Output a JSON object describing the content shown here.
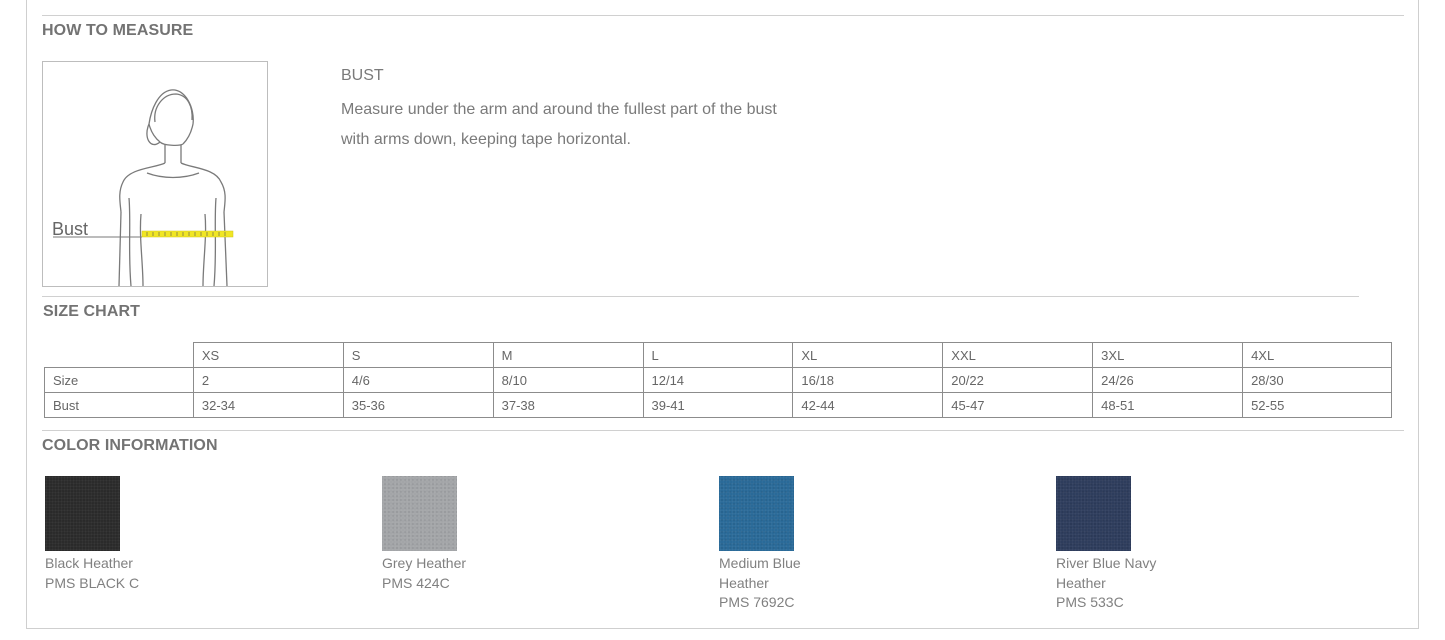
{
  "sections": {
    "how_to_measure": "HOW TO MEASURE",
    "size_chart": "SIZE CHART",
    "color_information": "COLOR INFORMATION"
  },
  "measure": {
    "figure_label": "Bust",
    "title": "BUST",
    "description_line1": "Measure under the arm and around the fullest part of the bust",
    "description_line2": "with arms down, keeping tape horizontal."
  },
  "size_table": {
    "headers": [
      "XS",
      "S",
      "M",
      "L",
      "XL",
      "XXL",
      "3XL",
      "4XL"
    ],
    "rows": [
      {
        "label": "Size",
        "values": [
          "2",
          "4/6",
          "8/10",
          "12/14",
          "16/18",
          "20/22",
          "24/26",
          "28/30"
        ]
      },
      {
        "label": "Bust",
        "values": [
          "32-34",
          "35-36",
          "37-38",
          "39-41",
          "42-44",
          "45-47",
          "48-51",
          "52-55"
        ]
      }
    ]
  },
  "colors": [
    {
      "name_lines": [
        "Black Heather"
      ],
      "pms": "PMS BLACK C",
      "swatch_color": "#2b2b2b"
    },
    {
      "name_lines": [
        "Grey Heather"
      ],
      "pms": "PMS 424C",
      "swatch_color": "#a3a5a8"
    },
    {
      "name_lines": [
        "Medium Blue",
        "Heather"
      ],
      "pms": "PMS 7692C",
      "swatch_color": "#2a6a98"
    },
    {
      "name_lines": [
        "River Blue Navy",
        "Heather"
      ],
      "pms": "PMS 533C",
      "swatch_color": "#2e3d5c"
    }
  ]
}
